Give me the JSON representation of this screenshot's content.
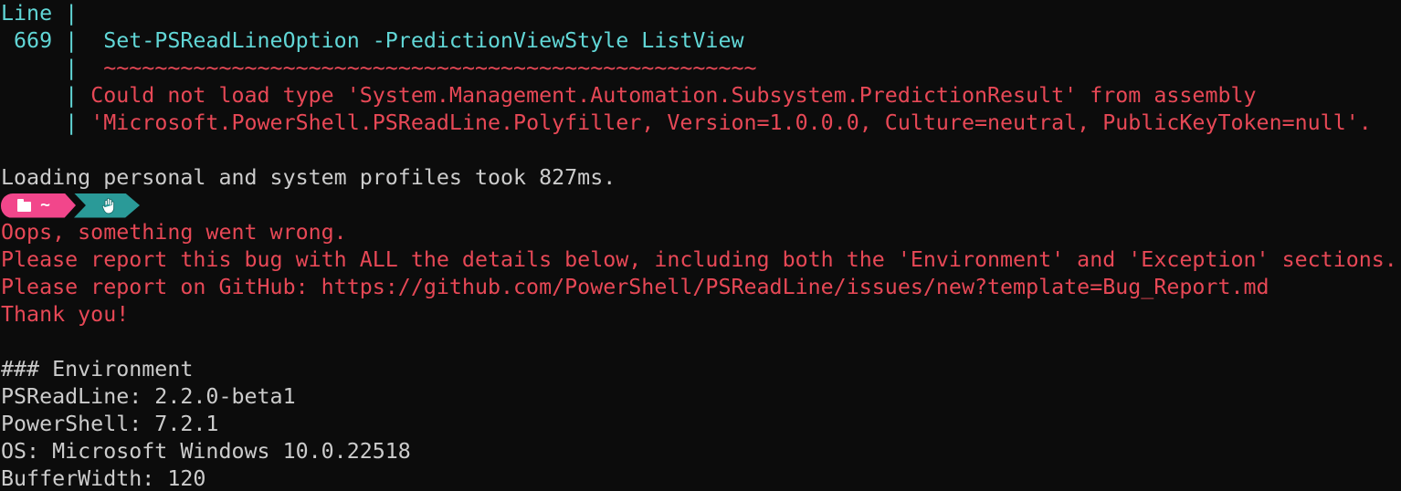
{
  "terminal": {
    "lines": [
      {
        "text": "Line |",
        "color": "#61d6d6"
      },
      {
        "text": " 669 |  Set-PSReadLineOption -PredictionViewStyle ListView",
        "color": "#61d6d6"
      },
      {
        "text": "     |  ~~~~~~~~~~~~~~~~~~~~~~~~~~~~~~~~~~~~~~~~~~~~~~~~~~~",
        "color": "#e74856"
      },
      {
        "text": "     | Could not load type 'System.Management.Automation.Subsystem.PredictionResult' from assembly",
        "color": "#e74856"
      },
      {
        "text": "     | 'Microsoft.PowerShell.PSReadLine.Polyfiller, Version=1.0.0.0, Culture=neutral, PublicKeyToken=null'.",
        "color": "#e74856"
      },
      {
        "text": "",
        "color": "#cccccc"
      },
      {
        "text": "Loading personal and system profiles took 827ms.",
        "color": "#cccccc"
      }
    ],
    "error_lines": [
      "Oops, something went wrong.",
      "Please report this bug with ALL the details below, including both the 'Environment' and 'Exception' sections.",
      "Please report on GitHub: https://github.com/PowerShell/PSReadLine/issues/new?template=Bug_Report.md",
      "Thank you!"
    ],
    "environment_lines": [
      "",
      "### Environment",
      "PSReadLine: 2.2.0-beta1",
      "PowerShell: 7.2.1",
      "OS: Microsoft Windows 10.0.22518",
      "BufferWidth: 120"
    ]
  },
  "prompt": {
    "path": "~",
    "folder_icon": "folder-icon",
    "status_icon": "hand-icon",
    "folder_color": "#f2468b",
    "status_color": "#2a9a98"
  },
  "colors": {
    "background": "#0c0c0c",
    "foreground": "#cccccc",
    "cyan": "#61d6d6",
    "red": "#e74856"
  }
}
